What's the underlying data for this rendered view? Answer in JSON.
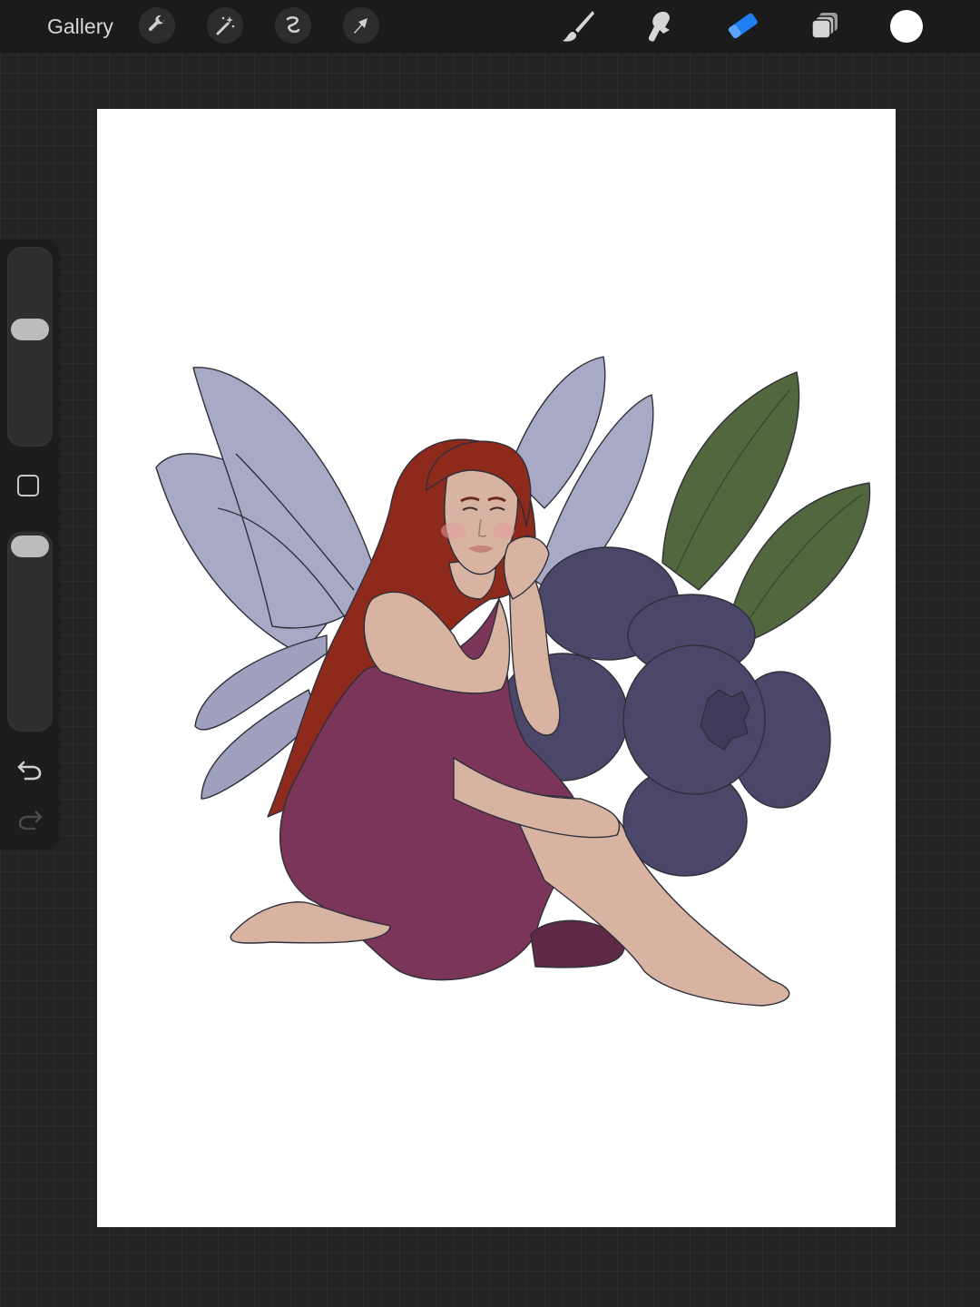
{
  "topbar": {
    "gallery_label": "Gallery",
    "left_tools": [
      "wrench-icon",
      "magic-wand-icon",
      "selection-icon",
      "transform-arrow-icon"
    ],
    "right_tools": [
      "brush-icon",
      "smudge-icon",
      "eraser-icon",
      "layers-icon"
    ],
    "active_tool": "eraser",
    "active_color": "#1e7ef2",
    "current_color": "#ffffff"
  },
  "sidebar": {
    "brush_size_level": 0.6,
    "opacity_level": 1.0
  },
  "artwork": {
    "palette": {
      "wings": "#a8a9c4",
      "hair": "#8e2a1c",
      "skin": "#d8b3a2",
      "dress": "#7a3558",
      "berries": "#4a4768",
      "leaves": "#53673f"
    }
  }
}
